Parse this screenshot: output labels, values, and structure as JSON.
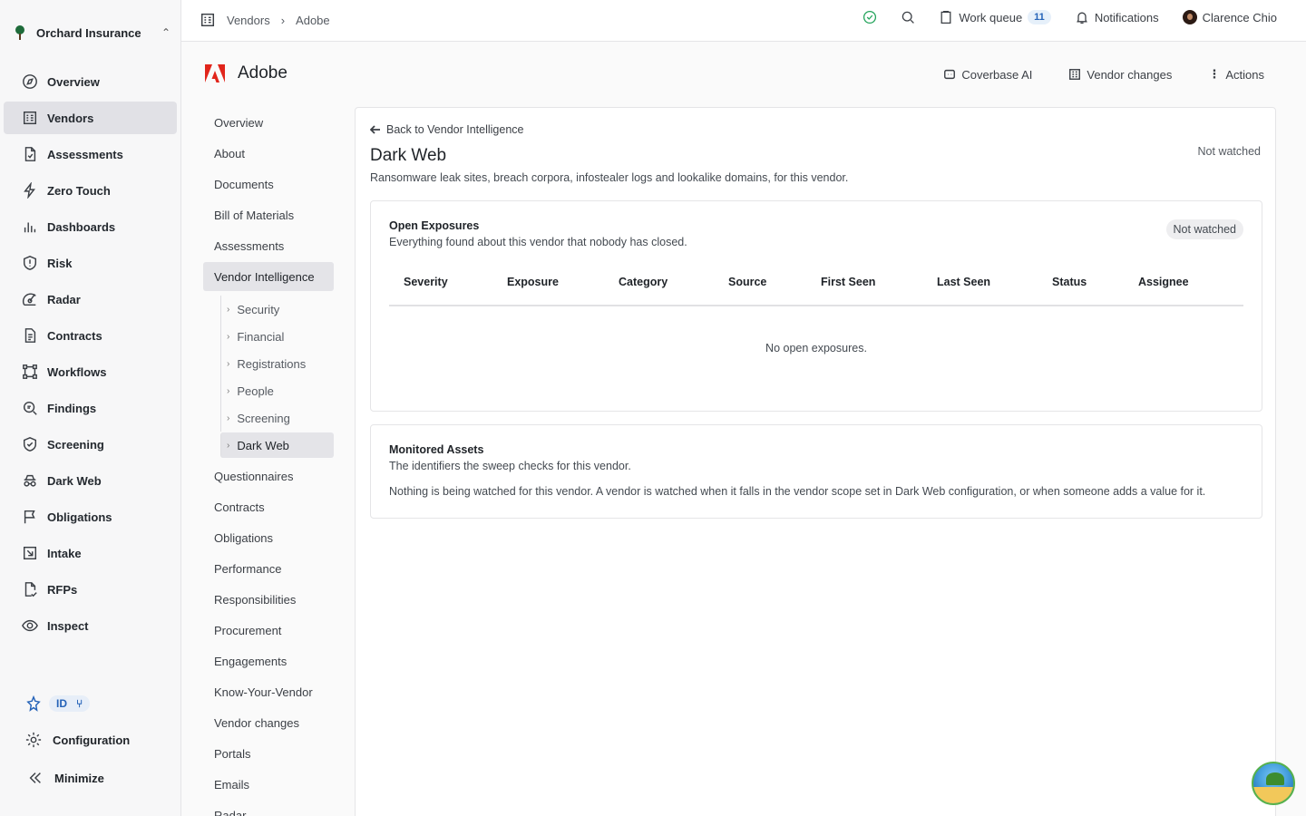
{
  "org": {
    "name": "Orchard Insurance"
  },
  "sidebar": {
    "items": [
      {
        "label": "Overview",
        "icon": "compass-icon"
      },
      {
        "label": "Vendors",
        "icon": "building-icon",
        "active": true
      },
      {
        "label": "Assessments",
        "icon": "file-check-icon"
      },
      {
        "label": "Zero Touch",
        "icon": "lightning-icon"
      },
      {
        "label": "Dashboards",
        "icon": "bar-chart-icon"
      },
      {
        "label": "Risk",
        "icon": "shield-alert-icon"
      },
      {
        "label": "Radar",
        "icon": "radar-icon"
      },
      {
        "label": "Contracts",
        "icon": "document-icon"
      },
      {
        "label": "Workflows",
        "icon": "workflow-icon"
      },
      {
        "label": "Findings",
        "icon": "magnify-list-icon"
      },
      {
        "label": "Screening",
        "icon": "shield-check-icon"
      },
      {
        "label": "Dark Web",
        "icon": "spy-icon"
      },
      {
        "label": "Obligations",
        "icon": "flag-icon"
      },
      {
        "label": "Intake",
        "icon": "inbox-arrow-icon"
      },
      {
        "label": "RFPs",
        "icon": "file-signature-icon"
      },
      {
        "label": "Inspect",
        "icon": "eye-icon"
      }
    ],
    "id_badge": "ID",
    "configuration": "Configuration",
    "minimize": "Minimize"
  },
  "topbar": {
    "breadcrumbs": [
      "Vendors",
      "Adobe"
    ],
    "work_queue": "Work queue",
    "work_queue_count": "11",
    "notifications": "Notifications",
    "user": "Clarence Chio"
  },
  "vendor": {
    "name": "Adobe",
    "actions": [
      "Coverbase AI",
      "Vendor changes",
      "Actions"
    ]
  },
  "subnav": {
    "items_before": [
      "Overview",
      "About",
      "Documents",
      "Bill of Materials",
      "Assessments"
    ],
    "active": "Vendor Intelligence",
    "children": [
      "Security",
      "Financial",
      "Registrations",
      "People",
      "Screening",
      "Dark Web"
    ],
    "items_after": [
      "Questionnaires",
      "Contracts",
      "Obligations",
      "Performance",
      "Responsibilities",
      "Procurement",
      "Engagements",
      "Know-Your-Vendor",
      "Vendor changes",
      "Portals",
      "Emails",
      "Radar"
    ]
  },
  "main": {
    "back_link": "Back to Vendor Intelligence",
    "title": "Dark Web",
    "watch_status": "Not watched",
    "description": "Ransomware leak sites, breach corpora, infostealer logs and lookalike domains, for this vendor.",
    "exposures": {
      "title": "Open Exposures",
      "subtitle": "Everything found about this vendor that nobody has closed.",
      "badge": "Not watched",
      "columns": [
        "Severity",
        "Exposure",
        "Category",
        "Source",
        "First Seen",
        "Last Seen",
        "Status",
        "Assignee"
      ],
      "empty": "No open exposures."
    },
    "assets": {
      "title": "Monitored Assets",
      "subtitle": "The identifiers the sweep checks for this vendor.",
      "body": "Nothing is being watched for this vendor. A vendor is watched when it falls in the vendor scope set in Dark Web configuration, or when someone adds a value for it."
    }
  },
  "colors": {
    "brand_red": "#e1251b",
    "accent_blue": "#2563b8",
    "status_green": "#22a35a"
  }
}
